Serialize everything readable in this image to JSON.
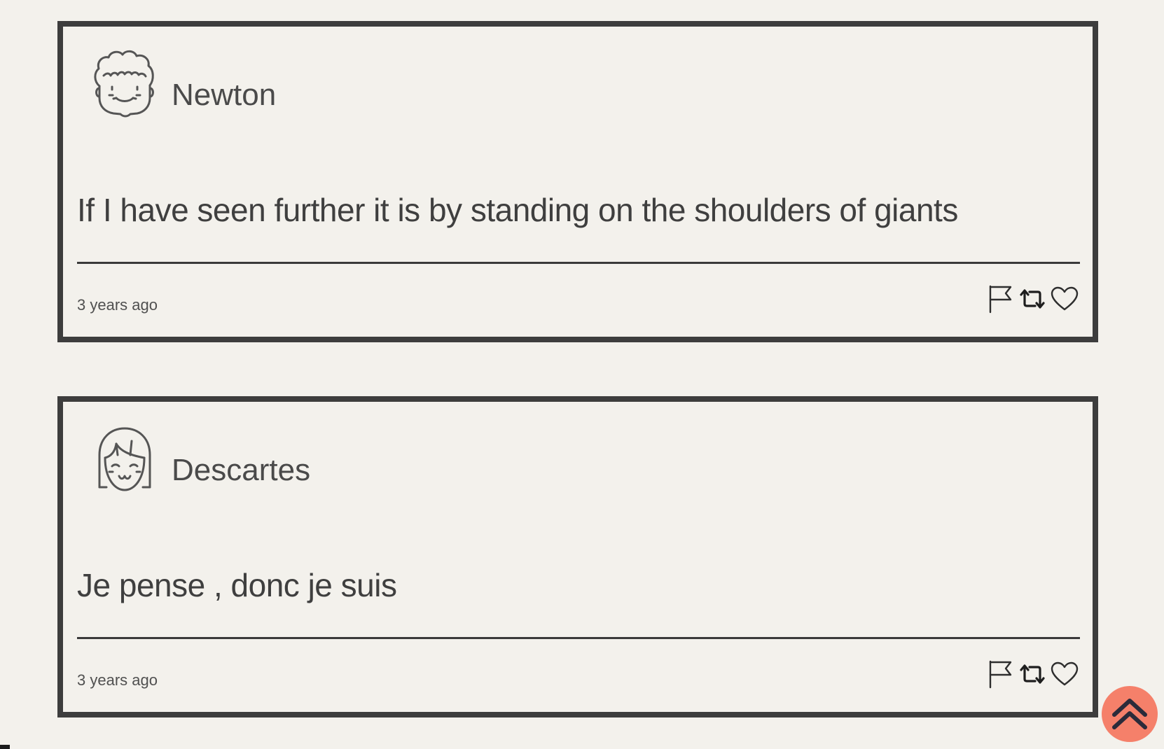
{
  "posts": [
    {
      "author": "Newton",
      "avatar_icon": "curly-haired-face-icon",
      "quote": "If I have seen further it is by standing on the shoulders of giants",
      "time": "3 years ago",
      "actions": [
        "flag-icon",
        "retweet-icon",
        "heart-icon"
      ]
    },
    {
      "author": "Descartes",
      "avatar_icon": "bob-haired-face-icon",
      "quote": "Je pense , donc je suis",
      "time": "3 years ago",
      "actions": [
        "flag-icon",
        "retweet-icon",
        "heart-icon"
      ]
    }
  ],
  "scroll_top": {
    "icon": "double-chevron-up-icon",
    "color": "#f5806a"
  },
  "colors": {
    "background": "#f3f1ec",
    "card_border": "#3d3d3d",
    "text": "#3f3f3f"
  }
}
